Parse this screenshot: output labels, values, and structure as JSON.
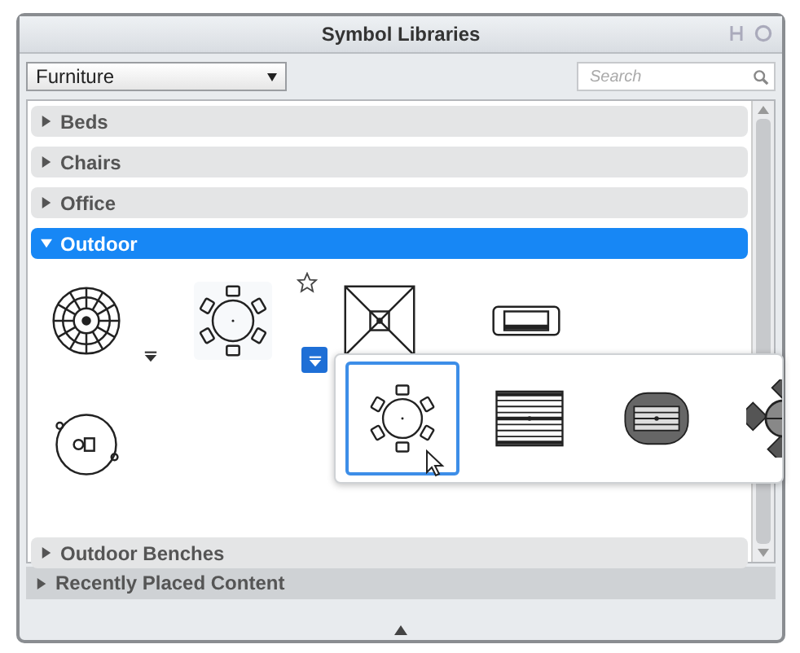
{
  "window": {
    "title": "Symbol Libraries"
  },
  "toolbar": {
    "library": "Furniture",
    "search": {
      "placeholder": "Search"
    }
  },
  "categories": [
    {
      "label": "Beds",
      "expanded": false,
      "selected": false
    },
    {
      "label": "Chairs",
      "expanded": false,
      "selected": false
    },
    {
      "label": "Office",
      "expanded": false,
      "selected": false
    },
    {
      "label": "Outdoor",
      "expanded": true,
      "selected": true,
      "symbols": [
        {
          "kind": "umbrella-table",
          "variants_open": false,
          "hovered": false
        },
        {
          "kind": "round-table",
          "variants_open": true,
          "hovered": true,
          "variants": [
            {
              "kind": "round-table",
              "selected": true
            },
            {
              "kind": "rect-table",
              "selected": false
            },
            {
              "kind": "oval-table",
              "selected": false
            },
            {
              "kind": "square-table",
              "selected": false
            }
          ]
        },
        {
          "kind": "square-umbrella",
          "hovered": false
        },
        {
          "kind": "grill",
          "hovered": false
        },
        {
          "kind": "hot-tub",
          "hovered": false
        }
      ]
    },
    {
      "label": "Outdoor Benches",
      "expanded": false,
      "selected": false
    }
  ],
  "recent": {
    "label": "Recently Placed Content",
    "expanded": false
  }
}
